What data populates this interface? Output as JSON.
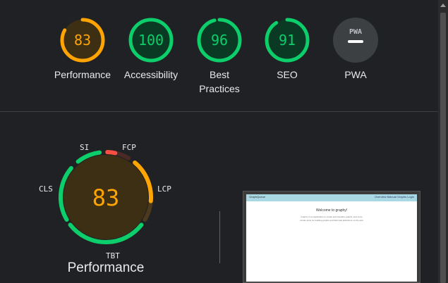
{
  "colors": {
    "pass": "#0cce6b",
    "average": "#ffa400",
    "fail": "#ff4e42",
    "track_pass": "#0a3a23",
    "track_average": "#3d2f14",
    "na": "#3c4043"
  },
  "gauges": [
    {
      "label_lines": [
        "Performance"
      ],
      "score": "83",
      "value": 83,
      "status": "average"
    },
    {
      "label_lines": [
        "Accessibility"
      ],
      "score": "100",
      "value": 100,
      "status": "pass"
    },
    {
      "label_lines": [
        "Best",
        "Practices"
      ],
      "score": "96",
      "value": 96,
      "status": "pass"
    },
    {
      "label_lines": [
        "SEO"
      ],
      "score": "91",
      "value": 91,
      "status": "pass"
    },
    {
      "label_lines": [
        "PWA"
      ],
      "badge_text": "PWA",
      "status": "na"
    }
  ],
  "performance": {
    "title": "Performance",
    "score": "83",
    "metrics": [
      {
        "name": "SI",
        "status": "pass"
      },
      {
        "name": "FCP",
        "status": "fail"
      },
      {
        "name": "LCP",
        "status": "average"
      },
      {
        "name": "TBT",
        "status": "pass"
      },
      {
        "name": "CLS",
        "status": "pass"
      }
    ]
  },
  "thumbnail": {
    "brand": "GraphQueue",
    "links": "Overview  Manual  Graphs  Login",
    "heading": "Welcome to graphy!",
    "lines": [
      "Graphy is an application to create and visualize graphs, and more",
      "simple tools for building graphs and Mermaid definitions on the web"
    ]
  }
}
